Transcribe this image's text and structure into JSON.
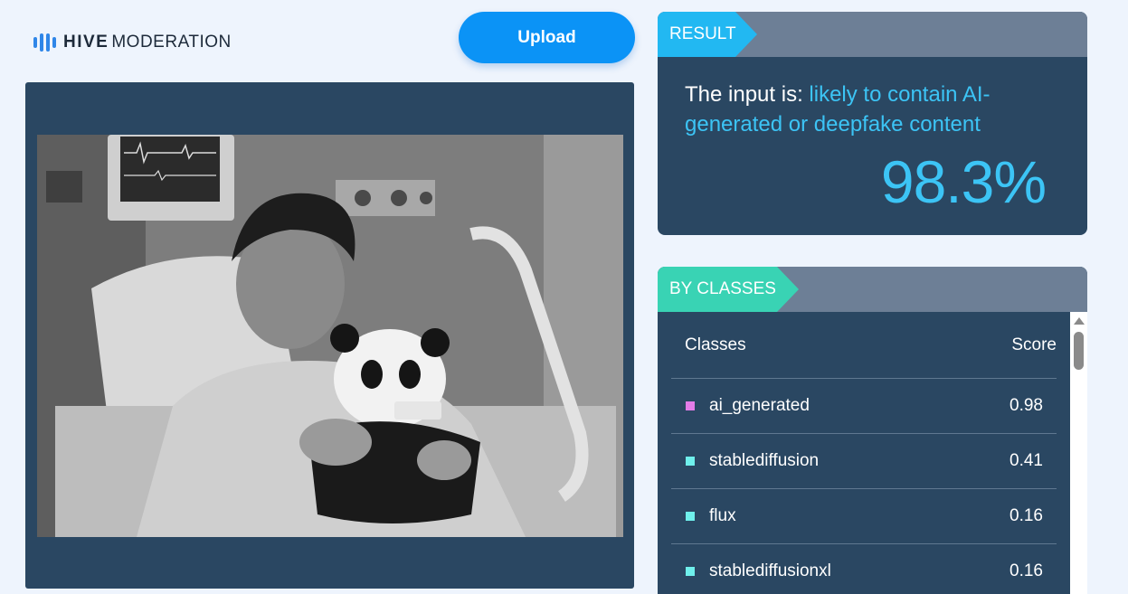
{
  "brand": {
    "strong": "HIVE",
    "light": "MODERATION"
  },
  "upload": {
    "label": "Upload"
  },
  "result": {
    "tag": "RESULT",
    "prefix": "The input is: ",
    "verdict": "likely to contain AI-generated or deepfake content",
    "percent": "98.3%"
  },
  "classes": {
    "tag": "BY CLASSES",
    "header": {
      "classes": "Classes",
      "score": "Score"
    },
    "rows": [
      {
        "name": "ai_generated",
        "score": "0.98",
        "color": "#e37ce8"
      },
      {
        "name": "stablediffusion",
        "score": "0.41",
        "color": "#6ff0ec"
      },
      {
        "name": "flux",
        "score": "0.16",
        "color": "#6ff0ec"
      },
      {
        "name": "stablediffusionxl",
        "score": "0.16",
        "color": "#6ff0ec"
      }
    ]
  },
  "colors": {
    "panel": "#2a4762",
    "accent_blue": "#22b8f2",
    "accent_teal": "#39d3b4",
    "button": "#0b93f6"
  }
}
